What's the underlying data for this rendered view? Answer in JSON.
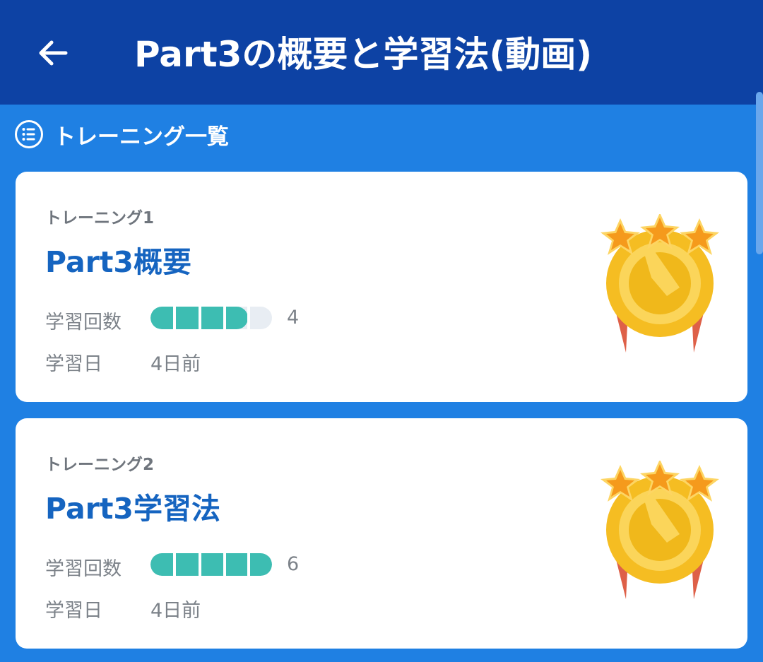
{
  "header": {
    "title": "Part3の概要と学習法(動画)",
    "back_icon": "arrow-left-icon"
  },
  "section": {
    "label": "トレーニング一覧",
    "icon": "list-icon"
  },
  "colors": {
    "appbar": "#0d42a4",
    "background": "#1f80e3",
    "card_title": "#1564c0",
    "progress_fill": "#3dbdb2",
    "progress_track": "#e8edf3"
  },
  "cards": [
    {
      "subtitle": "トレーニング1",
      "title": "Part3概要",
      "count_label": "学習回数",
      "count_value": "4",
      "progress_fraction": 0.8,
      "date_label": "学習日",
      "date_value": "4日前",
      "badge_icon": "gold-medal-icon"
    },
    {
      "subtitle": "トレーニング2",
      "title": "Part3学習法",
      "count_label": "学習回数",
      "count_value": "6",
      "progress_fraction": 1.0,
      "date_label": "学習日",
      "date_value": "4日前",
      "badge_icon": "gold-medal-icon"
    }
  ]
}
